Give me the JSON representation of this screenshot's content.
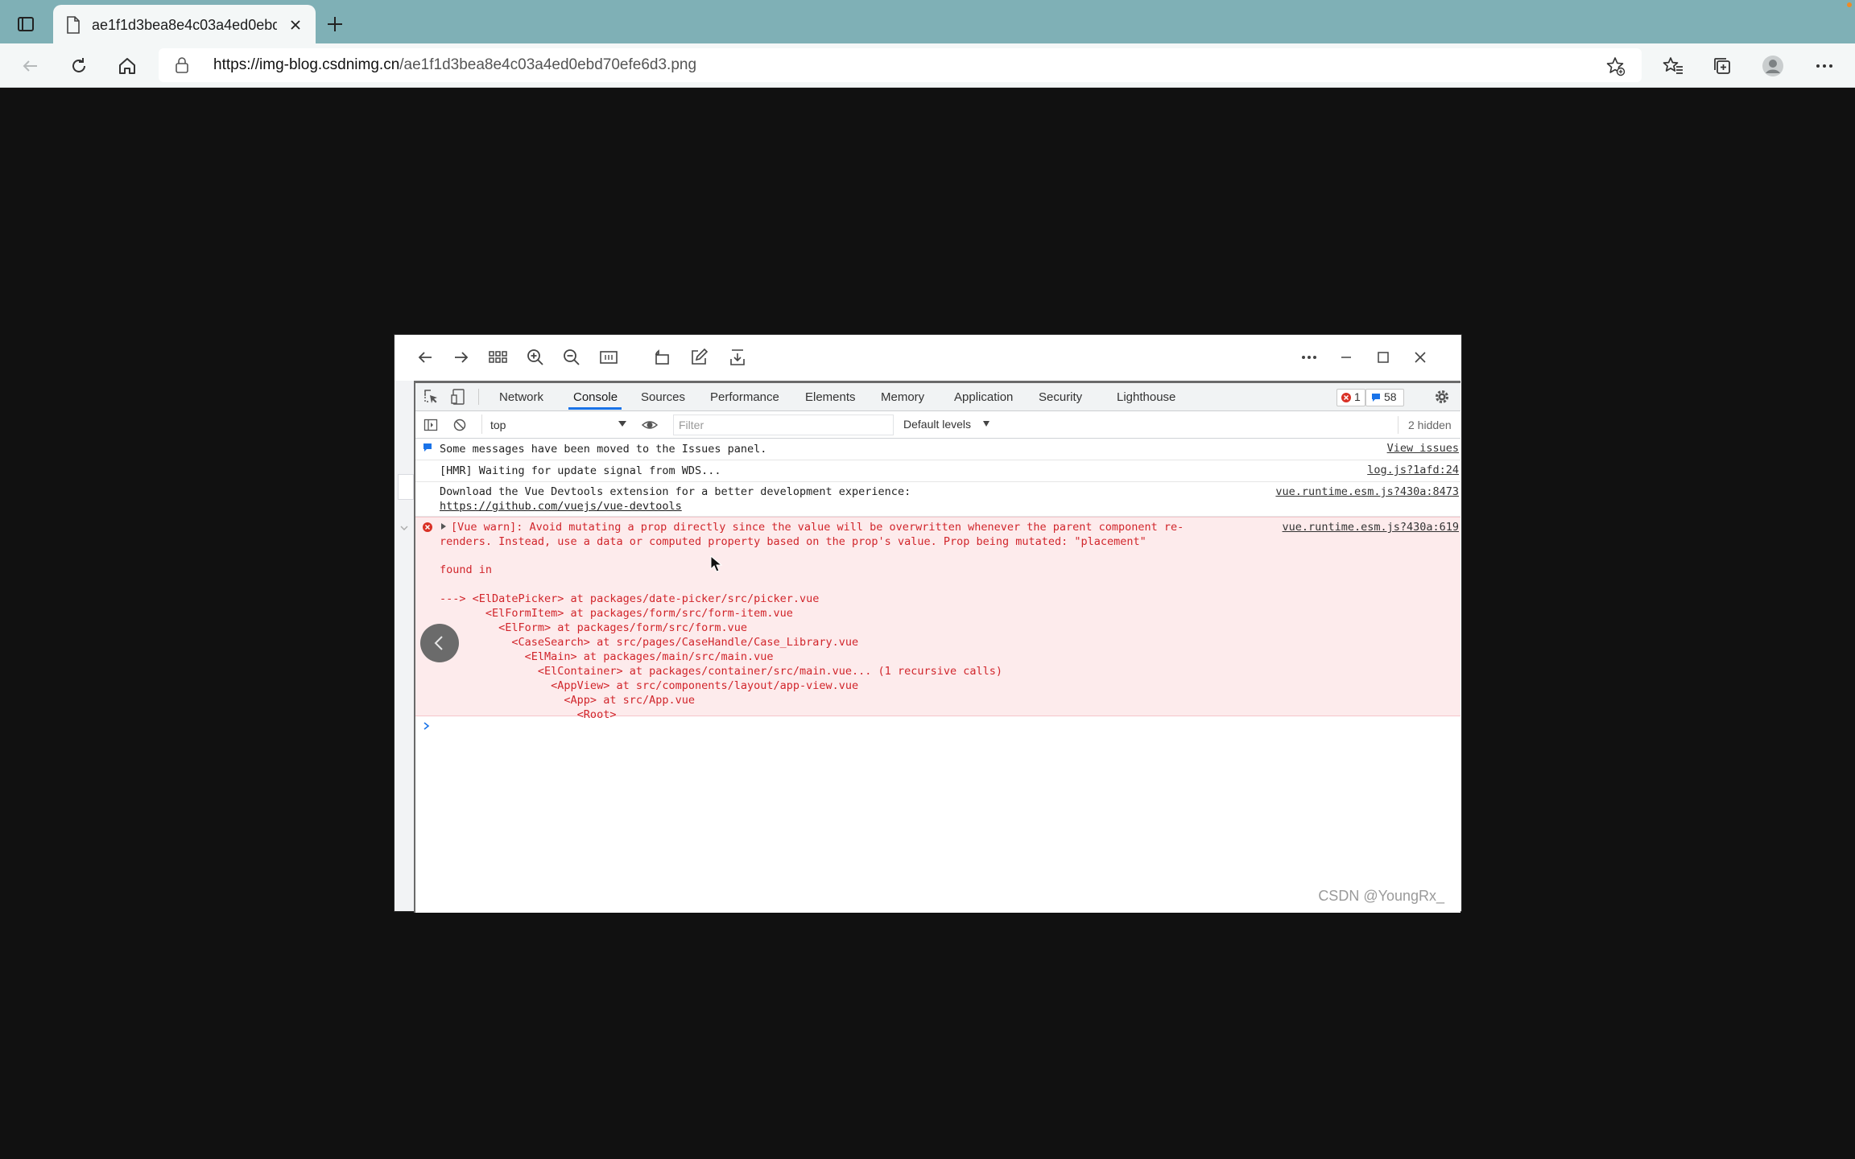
{
  "browser": {
    "tab_title": "ae1f1d3bea8e4c03a4ed0ebd70efe6d3.png",
    "url_host": "https://img-blog.csdnimg.cn",
    "url_path": "/ae1f1d3bea8e4c03a4ed0ebd70efe6d3.png"
  },
  "devtools": {
    "tabs": [
      "Network",
      "Console",
      "Sources",
      "Performance",
      "Elements",
      "Memory",
      "Application",
      "Security",
      "Lighthouse"
    ],
    "active_tab": "Console",
    "error_count": "1",
    "message_count": "58",
    "context": "top",
    "filter_placeholder": "Filter",
    "levels": "Default levels",
    "hidden": "2 hidden"
  },
  "console": {
    "issues_msg": "Some messages have been moved to the Issues panel.",
    "issues_link": "View issues",
    "hmr_msg": "[HMR] Waiting for update signal from WDS...",
    "hmr_src": "log.js?1afd:24",
    "vue_devtools_msg": "Download the Vue Devtools extension for a better development experience:",
    "vue_devtools_link": "https://github.com/vuejs/vue-devtools",
    "vue_devtools_src": "vue.runtime.esm.js?430a:8473",
    "warn_line1": "[Vue warn]: Avoid mutating a prop directly since the value will be overwritten whenever the parent component re-",
    "warn_line2": "renders. Instead, use a data or computed property based on the prop's value. Prop being mutated: \"placement\"",
    "warn_src": "vue.runtime.esm.js?430a:619",
    "found_in": "found in",
    "trace": [
      "---> <ElDatePicker> at packages/date-picker/src/picker.vue",
      "       <ElFormItem> at packages/form/src/form-item.vue",
      "         <ElForm> at packages/form/src/form.vue",
      "           <CaseSearch> at src/pages/CaseHandle/Case_Library.vue",
      "             <ElMain> at packages/main/src/main.vue",
      "               <ElContainer> at packages/container/src/main.vue... (1 recursive calls)",
      "                 <AppView> at src/components/layout/app-view.vue",
      "                   <App> at src/App.vue",
      "                     <Root>"
    ]
  },
  "watermark": "CSDN @YoungRx_"
}
